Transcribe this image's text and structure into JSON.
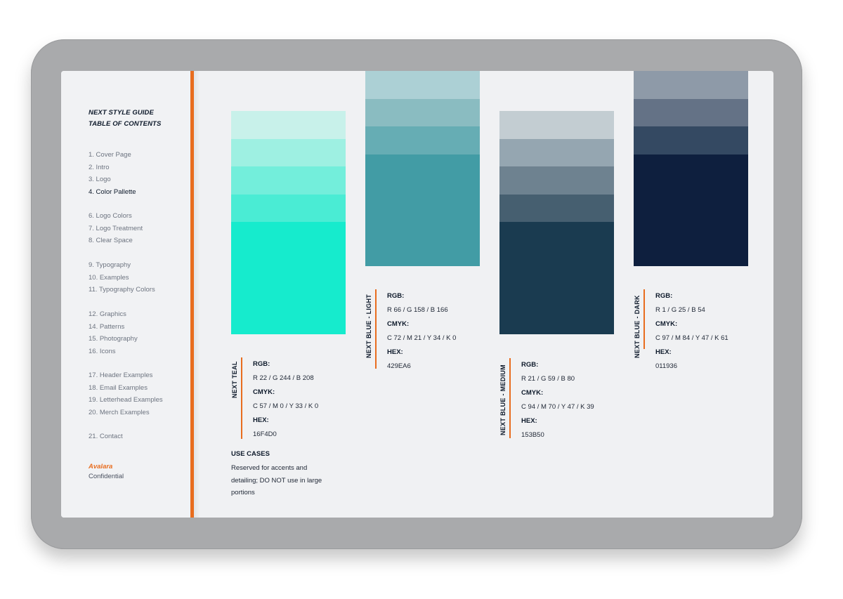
{
  "toc": {
    "title_line1": "NEXT STYLE GUIDE",
    "title_line2": "TABLE OF CONTENTS",
    "groups": [
      [
        "1.  Cover Page",
        "2.  Intro",
        "3. Logo",
        "4. Color Pallette"
      ],
      [
        "6. Logo Colors",
        "7. Logo Treatment",
        "8. Clear Space"
      ],
      [
        "9. Typography",
        "10. Examples",
        "11. Typography Colors"
      ],
      [
        "12. Graphics",
        "14. Patterns",
        "15. Photography",
        "16. Icons"
      ],
      [
        "17. Header Examples",
        "18. Email Examples",
        "19. Letterhead Examples",
        "20. Merch Examples"
      ],
      [
        "21. Contact"
      ]
    ],
    "active_item": "4. Color Pallette",
    "brand": "Avalara",
    "confidential": "Confidential"
  },
  "palettes": [
    {
      "name": "NEXT TEAL",
      "rgb_label": "RGB:",
      "rgb": "R 22 / G 244 / B 208",
      "cmyk_label": "CMYK:",
      "cmyk": "C 57 / M 0 / Y 33 / K 0",
      "hex_label": "HEX:",
      "hex": "16F4D0",
      "tints": [
        "#c8f1ea",
        "#9ef0e2",
        "#73eedb",
        "#4aecd4",
        "#16ebcd"
      ]
    },
    {
      "name": "NEXT BLUE - LIGHT",
      "rgb_label": "RGB:",
      "rgb": "R 66 / G 158 / B 166",
      "cmyk_label": "CMYK:",
      "cmyk": "C 72 / M 21 / Y 34 / K 0",
      "hex_label": "HEX:",
      "hex": "429EA6",
      "tints": [
        "#acd0d5",
        "#8abcc1",
        "#66adb4",
        "#429ca5"
      ]
    },
    {
      "name": "NEXT BLUE - MEDIUM",
      "rgb_label": "RGB:",
      "rgb": "R 21 / G 59 / B 80",
      "cmyk_label": "CMYK:",
      "cmyk": "C 94 / M 70 / Y 47 / K 39",
      "hex_label": "HEX:",
      "hex": "153B50",
      "tints": [
        "#c3cdd2",
        "#95a6b1",
        "#6e8290",
        "#465f70",
        "#1a3b50"
      ]
    },
    {
      "name": "NEXT BLUE - DARK",
      "rgb_label": "RGB:",
      "rgb": "R 1 / G 25 / B 54",
      "cmyk_label": "CMYK:",
      "cmyk": "C 97 / M 84 / Y 47 / K 61",
      "hex_label": "HEX:",
      "hex": "011936",
      "tints": [
        "#8e9aa8",
        "#647286",
        "#344962",
        "#0e1f3e"
      ]
    }
  ],
  "use_cases": {
    "title": "USE CASES",
    "text": "Reserved for accents and detailing; DO NOT use in large portions"
  },
  "colors": {
    "accent": "#e86d1f",
    "frame": "#a9aaac",
    "screen": "#f0f1f3"
  }
}
